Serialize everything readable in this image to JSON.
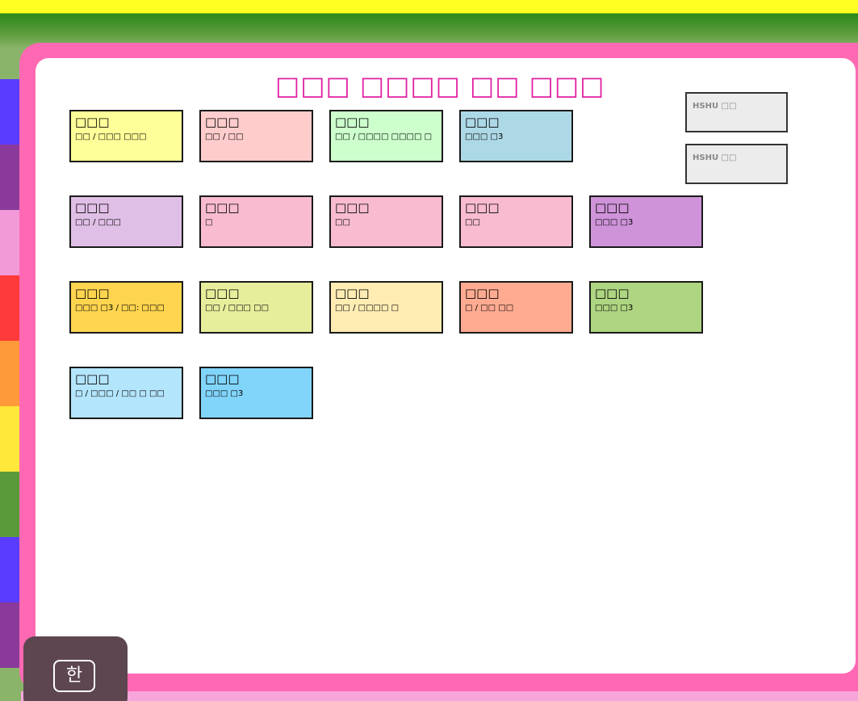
{
  "title": "□□□ □□□□ □□ □□□",
  "colors": {
    "frame_pink": "#ff69b4",
    "title_magenta": "#e020a0",
    "top_yellow": "#ffff22"
  },
  "rainbow_strip": [
    "#5a3cff",
    "#8a3a9a",
    "#f29ad8",
    "#ff3a3a",
    "#ff9a3a",
    "#ffe83a",
    "#5a9a3a",
    "#5a3cff",
    "#8a3a9a"
  ],
  "cards": [
    {
      "name": "□□□",
      "desc": "□□ / □□□ □□□",
      "color": "#ffff99"
    },
    {
      "name": "□□□",
      "desc": "□□ / □□",
      "color": "#ffcccc"
    },
    {
      "name": "□□□",
      "desc": "□□ / □□□□ □□□□ □",
      "color": "#ccffcc"
    },
    {
      "name": "□□□",
      "desc": "□□□ □3",
      "color": "#add8e6"
    },
    {
      "name": "□□□",
      "desc": "□□ / □□□",
      "color": "#e0bfe6"
    },
    {
      "name": "□□□",
      "desc": "□",
      "color": "#f8bbd0"
    },
    {
      "name": "□□□",
      "desc": "□□",
      "color": "#f8bbd0"
    },
    {
      "name": "□□□",
      "desc": "□□",
      "color": "#f8bbd0"
    },
    {
      "name": "□□□",
      "desc": "□□□ □3",
      "color": "#ce93d8"
    },
    {
      "name": "□□□",
      "desc": "□□□ □3 / □□: □□□",
      "color": "#ffd54f"
    },
    {
      "name": "□□□",
      "desc": "□□ / □□□ □□",
      "color": "#e6ee9c"
    },
    {
      "name": "□□□",
      "desc": "□□ / □□□□ □",
      "color": "#ffecb3"
    },
    {
      "name": "□□□",
      "desc": "□ / □□ □□",
      "color": "#ffab91"
    },
    {
      "name": "□□□",
      "desc": "□□□ □3",
      "color": "#aed581"
    },
    {
      "name": "□□□",
      "desc": "□ / □□□ / □□ □ □□",
      "color": "#b3e5fc"
    },
    {
      "name": "□□□",
      "desc": "□□□ □3",
      "color": "#81d4fa"
    }
  ],
  "hshu_buttons": [
    "HSHU □□",
    "HSHU □□"
  ],
  "ime": {
    "label": "한"
  }
}
